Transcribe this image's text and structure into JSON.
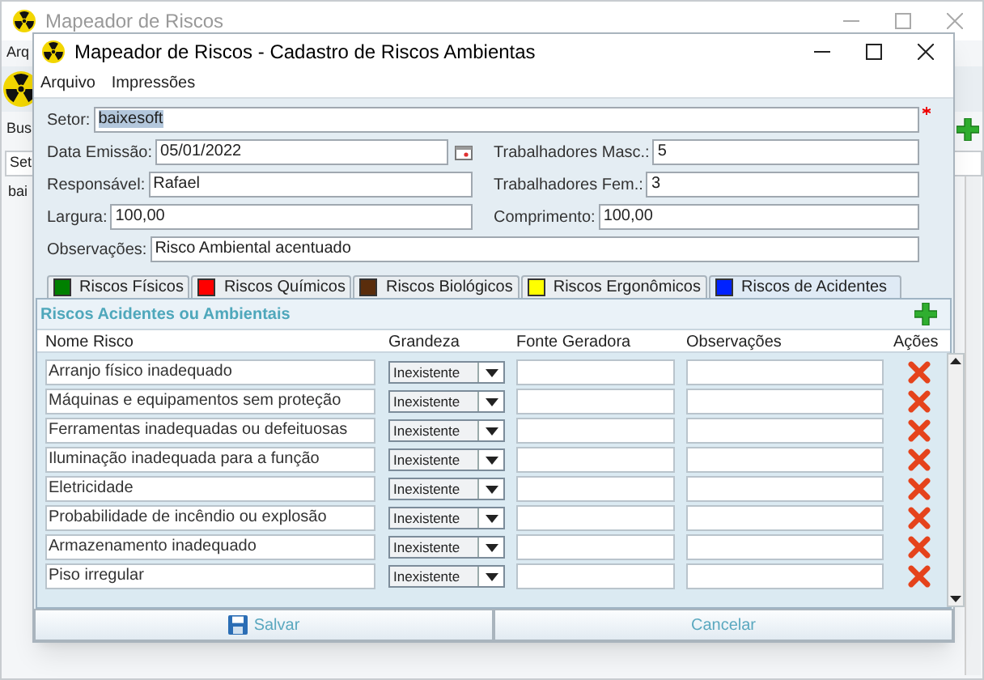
{
  "background_window": {
    "title": "Mapeador de Riscos",
    "menu_item": "Arq",
    "search_label": "Bus",
    "column_heading": "Set",
    "row_cell": "bai"
  },
  "dialog": {
    "title": "Mapeador de Riscos - Cadastro de Riscos Ambientas",
    "menu": [
      "Arquivo",
      "Impressões"
    ],
    "form_rows": [
      [
        {
          "label": "Setor:",
          "value": "baixesoft",
          "required": true,
          "value_selected": true,
          "kind": "text"
        }
      ],
      [
        {
          "label": "Data Emissão:",
          "value": "05/01/2022",
          "kind": "date"
        },
        {
          "label": "Trabalhadores Masc.:",
          "value": "5",
          "kind": "text"
        }
      ],
      [
        {
          "label": "Responsável:",
          "value": "Rafael",
          "kind": "text"
        },
        {
          "label": "Trabalhadores Fem.:",
          "value": "3",
          "kind": "text"
        }
      ],
      [
        {
          "label": "Largura:",
          "value": "100,00",
          "kind": "text"
        },
        {
          "label": "Comprimento:",
          "value": "100,00",
          "kind": "text"
        }
      ],
      [
        {
          "label": "Observações:",
          "value": "Risco Ambiental acentuado",
          "kind": "text"
        }
      ]
    ],
    "tabs": [
      {
        "label": "Riscos Físicos",
        "color": "#008000",
        "selected": false
      },
      {
        "label": "Riscos Químicos",
        "color": "#ff0000",
        "selected": false
      },
      {
        "label": "Riscos Biológicos",
        "color": "#5a2d0c",
        "selected": false
      },
      {
        "label": "Riscos Ergonômicos",
        "color": "#ffff00",
        "selected": false
      },
      {
        "label": "Riscos de Acidentes",
        "color": "#0022ff",
        "selected": true
      }
    ],
    "panel": {
      "title": "Riscos Acidentes ou Ambientais",
      "columns": [
        "Nome Risco",
        "Grandeza",
        "Fonte Geradora",
        "Observações",
        "Ações"
      ],
      "rows": [
        {
          "name": "Arranjo físico inadequado",
          "grandeza": "Inexistente"
        },
        {
          "name": "Máquinas e equipamentos sem proteção",
          "grandeza": "Inexistente"
        },
        {
          "name": "Ferramentas inadequadas ou defeituosas",
          "grandeza": "Inexistente"
        },
        {
          "name": "Iluminação inadequada para a função",
          "grandeza": "Inexistente"
        },
        {
          "name": "Eletricidade",
          "grandeza": "Inexistente"
        },
        {
          "name": "Probabilidade de incêndio ou explosão",
          "grandeza": "Inexistente"
        },
        {
          "name": "Armazenamento inadequado",
          "grandeza": "Inexistente"
        },
        {
          "name": "Piso irregular",
          "grandeza": "Inexistente"
        }
      ]
    },
    "buttons": [
      {
        "label": "Salvar",
        "kind": "save"
      },
      {
        "label": "Cancelar",
        "kind": "cancel"
      }
    ]
  }
}
